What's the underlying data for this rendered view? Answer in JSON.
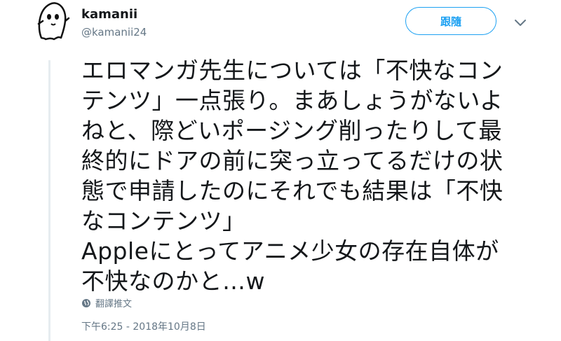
{
  "author": {
    "display_name": "kamanii",
    "handle": "@kamanii24",
    "avatar_icon": "ghost-doodle-avatar"
  },
  "follow_button": {
    "label": "跟隨"
  },
  "menu": {
    "icon": "chevron-down-icon"
  },
  "tweet": {
    "lines": [
      "エロマンガ先生については「不快なコン",
      "テンツ」一点張り。まあしょうがないよ",
      "ねと、際どいポージング削ったりして最",
      "終的にドアの前に突っ立ってるだけの状",
      "態で申請したのにそれでも結果は「不快",
      "なコンテンツ」",
      "Appleにとってアニメ少女の存在自体が",
      "不快なのかと…w"
    ]
  },
  "translate": {
    "label": "翻譯推文",
    "icon": "globe-icon"
  },
  "timestamp": "下午6:25 - 2018年10月8日",
  "colors": {
    "accent": "#1da1f2",
    "muted": "#657786",
    "text": "#14171a",
    "thread_line": "#e6ecf0"
  }
}
